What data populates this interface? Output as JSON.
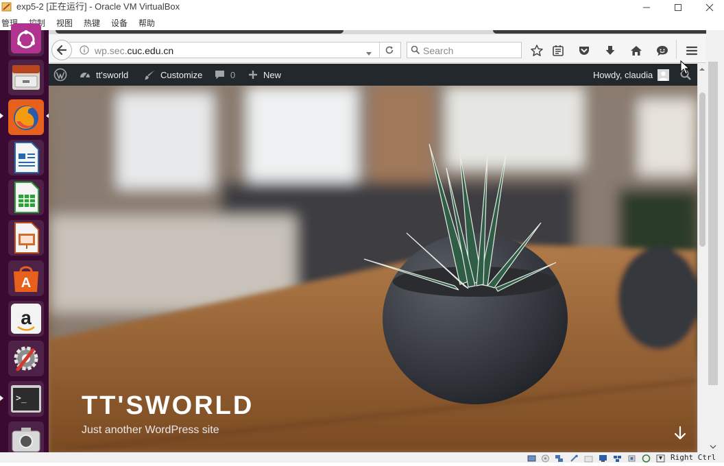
{
  "host": {
    "title": "exp5-2 [正在运行] - Oracle VM VirtualBox",
    "menu": [
      "管理",
      "控制",
      "视图",
      "热键",
      "设备",
      "帮助"
    ],
    "host_key": "Right Ctrl"
  },
  "launcher": {
    "items": [
      "ubuntu-dash-icon",
      "files-icon",
      "firefox-icon",
      "writer-icon",
      "calc-icon",
      "impress-icon",
      "software-center-icon",
      "amazon-icon",
      "system-settings-icon",
      "terminal-icon",
      "camera-icon"
    ]
  },
  "browser": {
    "url_host_prefix": "wp.sec.",
    "url_domain": "cuc.edu.cn",
    "search_placeholder": "Search"
  },
  "adminbar": {
    "site_name": "tt'sworld",
    "customize": "Customize",
    "comments_count": "0",
    "new": "New",
    "howdy": "Howdy, claudia"
  },
  "hero": {
    "site_title": "TT'SWORLD",
    "site_description": "Just another WordPress site"
  },
  "colors": {
    "launcher_bg": "#3a0a33",
    "adminbar_bg": "#23282d",
    "firefox_orange": "#e8611c"
  }
}
